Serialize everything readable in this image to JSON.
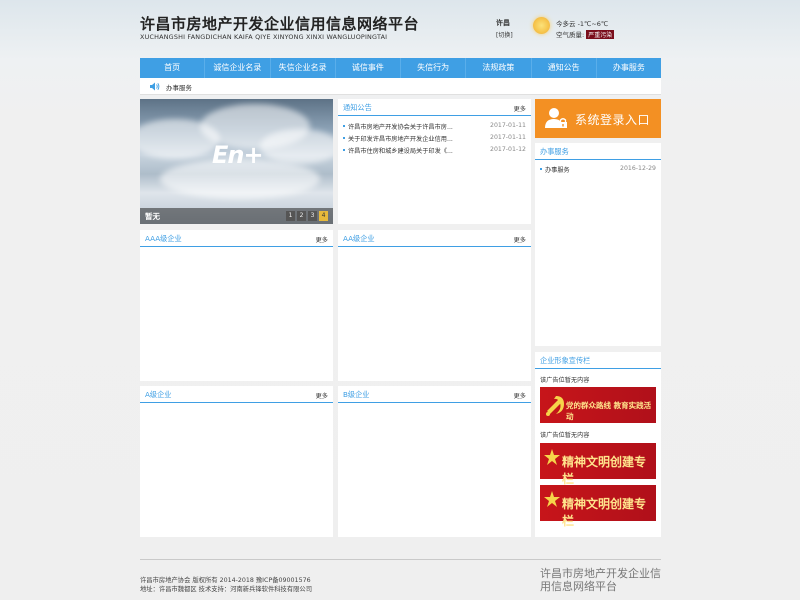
{
  "header": {
    "title": "许昌市房地产开发企业信用信息网络平台",
    "subtitle": "XUCHANGSHI FANGDICHAN KAIFA QIYE XINYONG XINXI WANGLUOPINGTAI",
    "city": "许昌",
    "switch_label": "[切换]",
    "weather": "今多云   -1℃~6℃",
    "air_label": "空气质量:",
    "air_value": "严重污染",
    "air_color": "#7a0e1c"
  },
  "nav": {
    "items": [
      "首页",
      "诚信企业名录",
      "失信企业名录",
      "诚信事件",
      "失信行为",
      "法规政策",
      "通知公告",
      "办事服务"
    ]
  },
  "subbar": {
    "text": "办事服务"
  },
  "slideshow": {
    "caption": "暂无",
    "logo_text": "En+",
    "pages": [
      "1",
      "2",
      "3",
      "4"
    ],
    "active_page": 4
  },
  "notices": {
    "title": "通知公告",
    "more": "更多",
    "items": [
      {
        "title": "许昌市房地产开发协会关于许昌市房...",
        "date": "2017-01-11"
      },
      {
        "title": "关于印发许昌市房地产开发企业信用...",
        "date": "2017-01-11"
      },
      {
        "title": "许昌市住房和城乡建设局关于印发《...",
        "date": "2017-01-12"
      }
    ]
  },
  "login": {
    "label": "系统登录入口"
  },
  "services": {
    "title": "办事服务",
    "items": [
      {
        "title": "办事服务",
        "date": "2016-12-29"
      }
    ]
  },
  "aaa": {
    "title": "AAA级企业",
    "more": "更多"
  },
  "aa": {
    "title": "AA级企业",
    "more": "更多"
  },
  "a": {
    "title": "A级企业",
    "more": "更多"
  },
  "b": {
    "title": "B级企业",
    "more": "更多"
  },
  "promo": {
    "title": "企业形象宣传栏",
    "ad_empty_1": "该广告位暂无内容",
    "ad_empty_2": "该广告位暂无内容",
    "banner1": "党的群众路线  教育实践活动",
    "banner2": "精神文明创建专栏",
    "banner3": "精神文明创建专栏"
  },
  "footer": {
    "line1": "许昌市房地产协会 版权所有 2014-2018 豫ICP备09001576",
    "line2": "地址：许昌市魏都区 技术支持：河南新兵锋软件科技有限公司",
    "logo_text": "许昌市房地产开发企业信用信息网络平台"
  },
  "colors": {
    "accent": "#3f9fe4",
    "login": "#f39023",
    "banner_red": "#c7151a"
  }
}
